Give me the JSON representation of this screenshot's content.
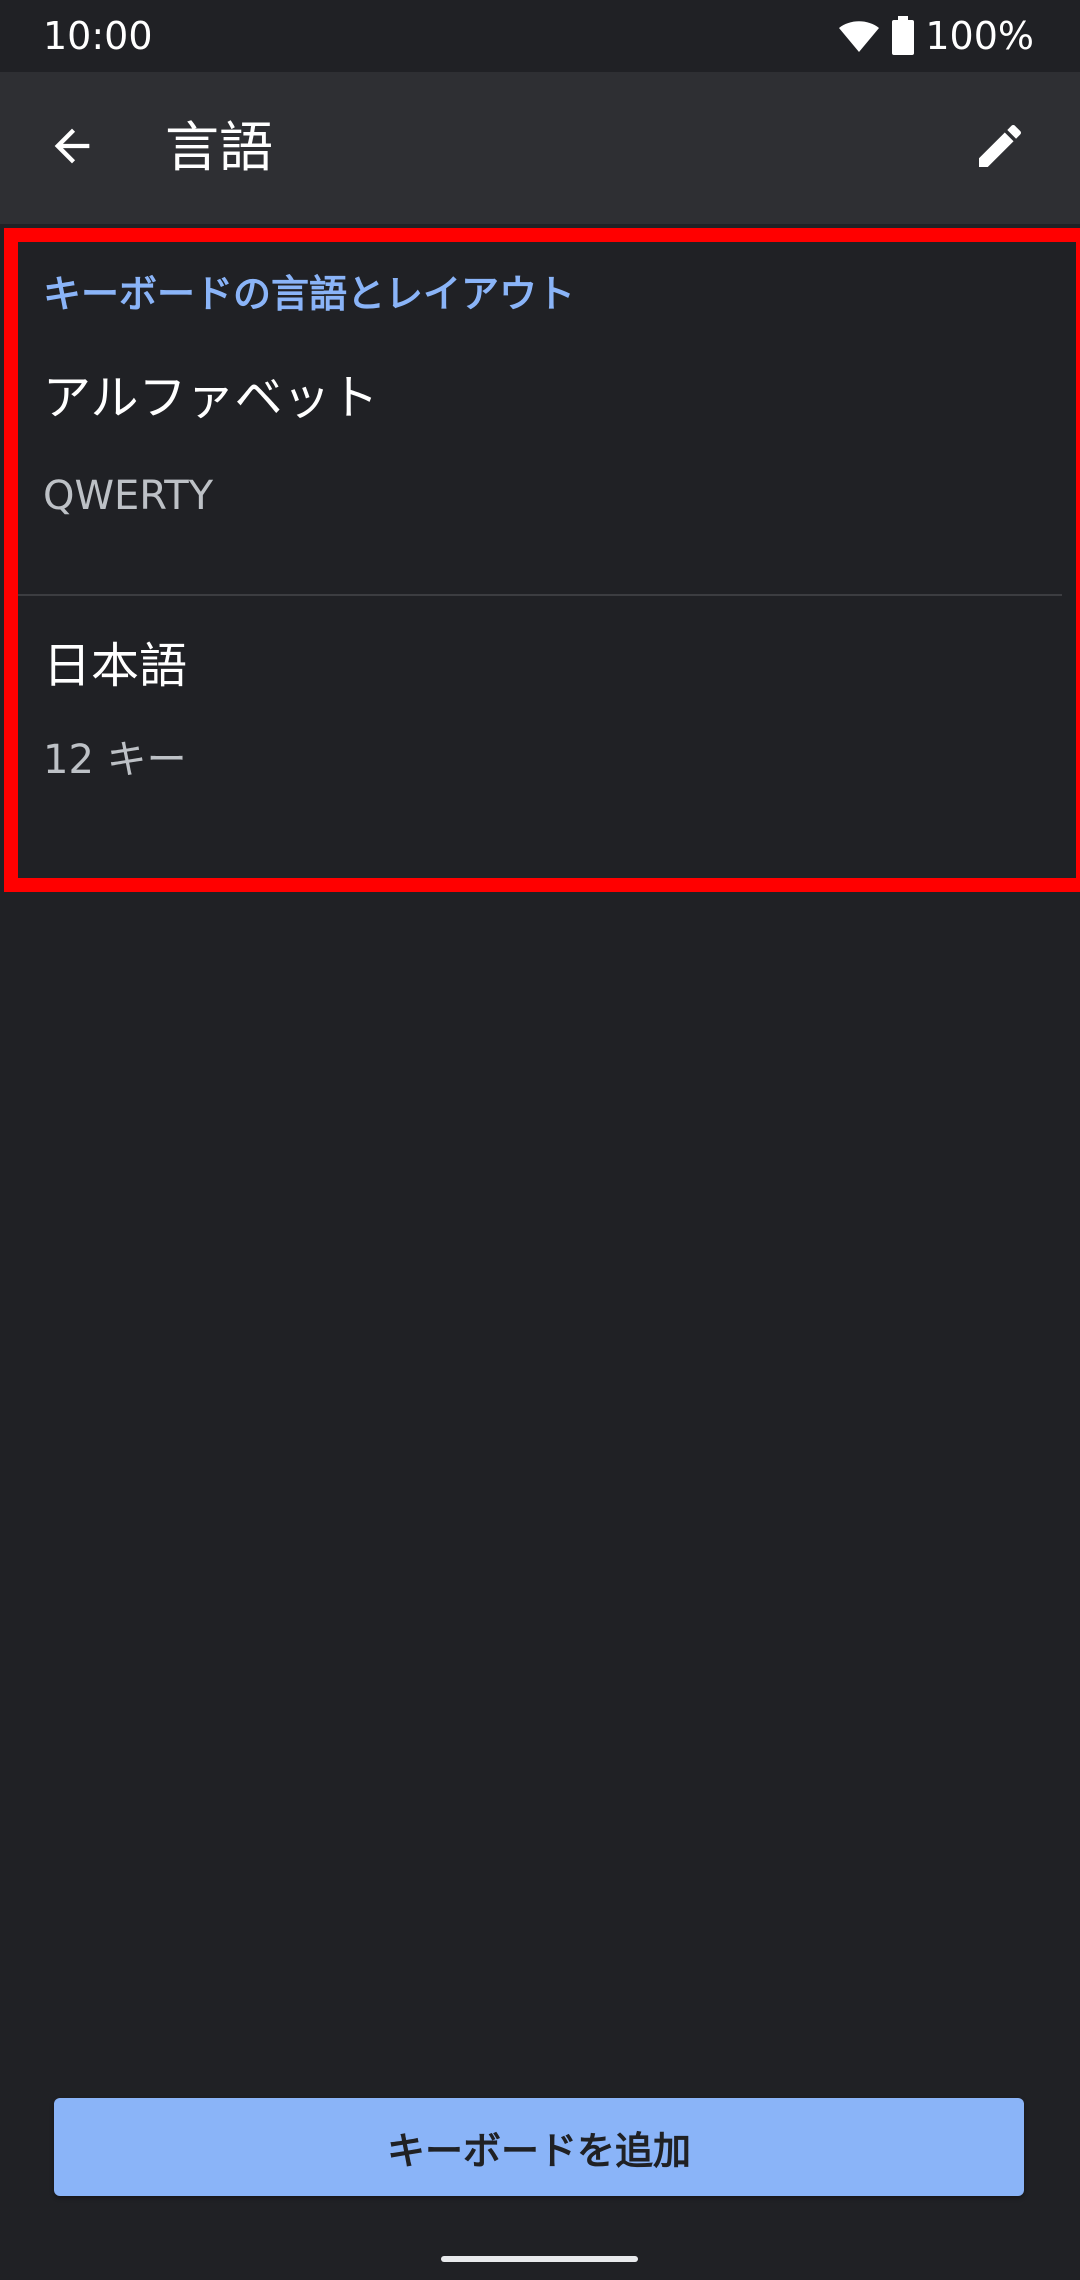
{
  "status_bar": {
    "time": "10:00",
    "battery": "100%",
    "icons": [
      "wifi-icon",
      "battery-icon"
    ]
  },
  "app_bar": {
    "title": "言語",
    "back_icon": "arrow-back-icon",
    "edit_icon": "pencil-icon"
  },
  "section": {
    "header": "キーボードの言語とレイアウト",
    "items": [
      {
        "title": "アルファベット",
        "subtitle": "QWERTY"
      },
      {
        "title": "日本語",
        "subtitle": "12 キー"
      }
    ]
  },
  "footer": {
    "add_button_label": "キーボードを追加"
  },
  "colors": {
    "background": "#202125",
    "app_bar": "#2e2f33",
    "accent": "#8ab4f8",
    "highlight": "#ff0000"
  }
}
